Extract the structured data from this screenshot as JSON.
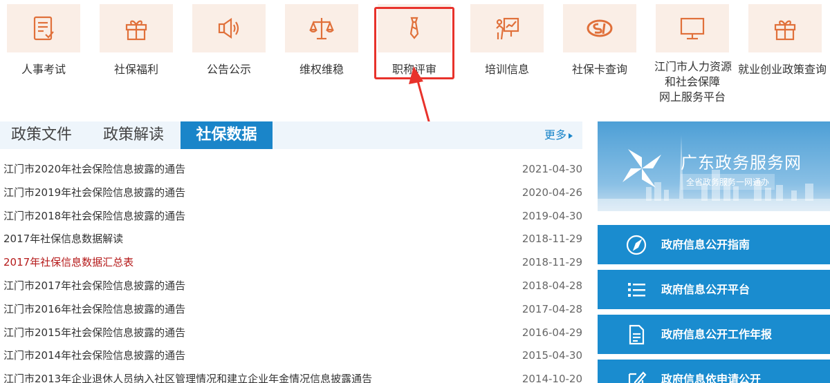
{
  "icons": [
    {
      "label": "人事考试",
      "icon": "exam-list-icon"
    },
    {
      "label": "社保福利",
      "icon": "gift-icon"
    },
    {
      "label": "公告公示",
      "icon": "megaphone-icon"
    },
    {
      "label": "维权维稳",
      "icon": "scales-icon"
    },
    {
      "label": "职称评审",
      "icon": "tie-icon"
    },
    {
      "label": "培训信息",
      "icon": "presentation-icon"
    },
    {
      "label": "社保卡查询",
      "icon": "si-logo-icon"
    },
    {
      "label_lines": [
        "江门市人力资源",
        "和社会保障",
        "网上服务平台"
      ],
      "icon": "monitor-icon"
    },
    {
      "label": "就业创业政策查询",
      "icon": "gift-icon"
    }
  ],
  "tabs": {
    "policy_files": "政策文件",
    "policy_interpretation": "政策解读",
    "social_security_data": "社保数据",
    "more": "更多"
  },
  "news": [
    {
      "title": "江门市2020年社会保险信息披露的通告",
      "date": "2021-04-30"
    },
    {
      "title": "江门市2019年社会保险信息披露的通告",
      "date": "2020-04-26"
    },
    {
      "title": "江门市2018年社会保险信息披露的通告",
      "date": "2019-04-30"
    },
    {
      "title": "2017年社保信息数据解读",
      "date": "2018-11-29"
    },
    {
      "title": "2017年社保信息数据汇总表",
      "date": "2018-11-29",
      "highlight": true
    },
    {
      "title": "江门市2017年社会保险信息披露的通告",
      "date": "2018-04-28"
    },
    {
      "title": "江门市2016年社会保险信息披露的通告",
      "date": "2017-04-28"
    },
    {
      "title": "江门市2015年社会保险信息披露的通告",
      "date": "2016-04-29"
    },
    {
      "title": "江门市2014年社会保险信息披露的通告",
      "date": "2015-04-30"
    },
    {
      "title": "江门市2013年企业退休人员纳入社区管理情况和建立企业年金情况信息披露通告",
      "date": "2014-10-20"
    }
  ],
  "banner": {
    "title": "广东政务服务网",
    "subtitle": "全省政务服务一网通办"
  },
  "side_buttons": [
    {
      "label": "政府信息公开指南",
      "icon": "compass-icon"
    },
    {
      "label": "政府信息公开平台",
      "icon": "list-icon"
    },
    {
      "label": "政府信息公开工作年报",
      "icon": "document-icon"
    },
    {
      "label": "政府信息依申请公开",
      "icon": "edit-icon"
    }
  ],
  "colors": {
    "accent": "#1a85c9",
    "icon_bg": "#faeee6",
    "icon_stroke": "#e0703a",
    "highlight_red": "#e8322b"
  }
}
